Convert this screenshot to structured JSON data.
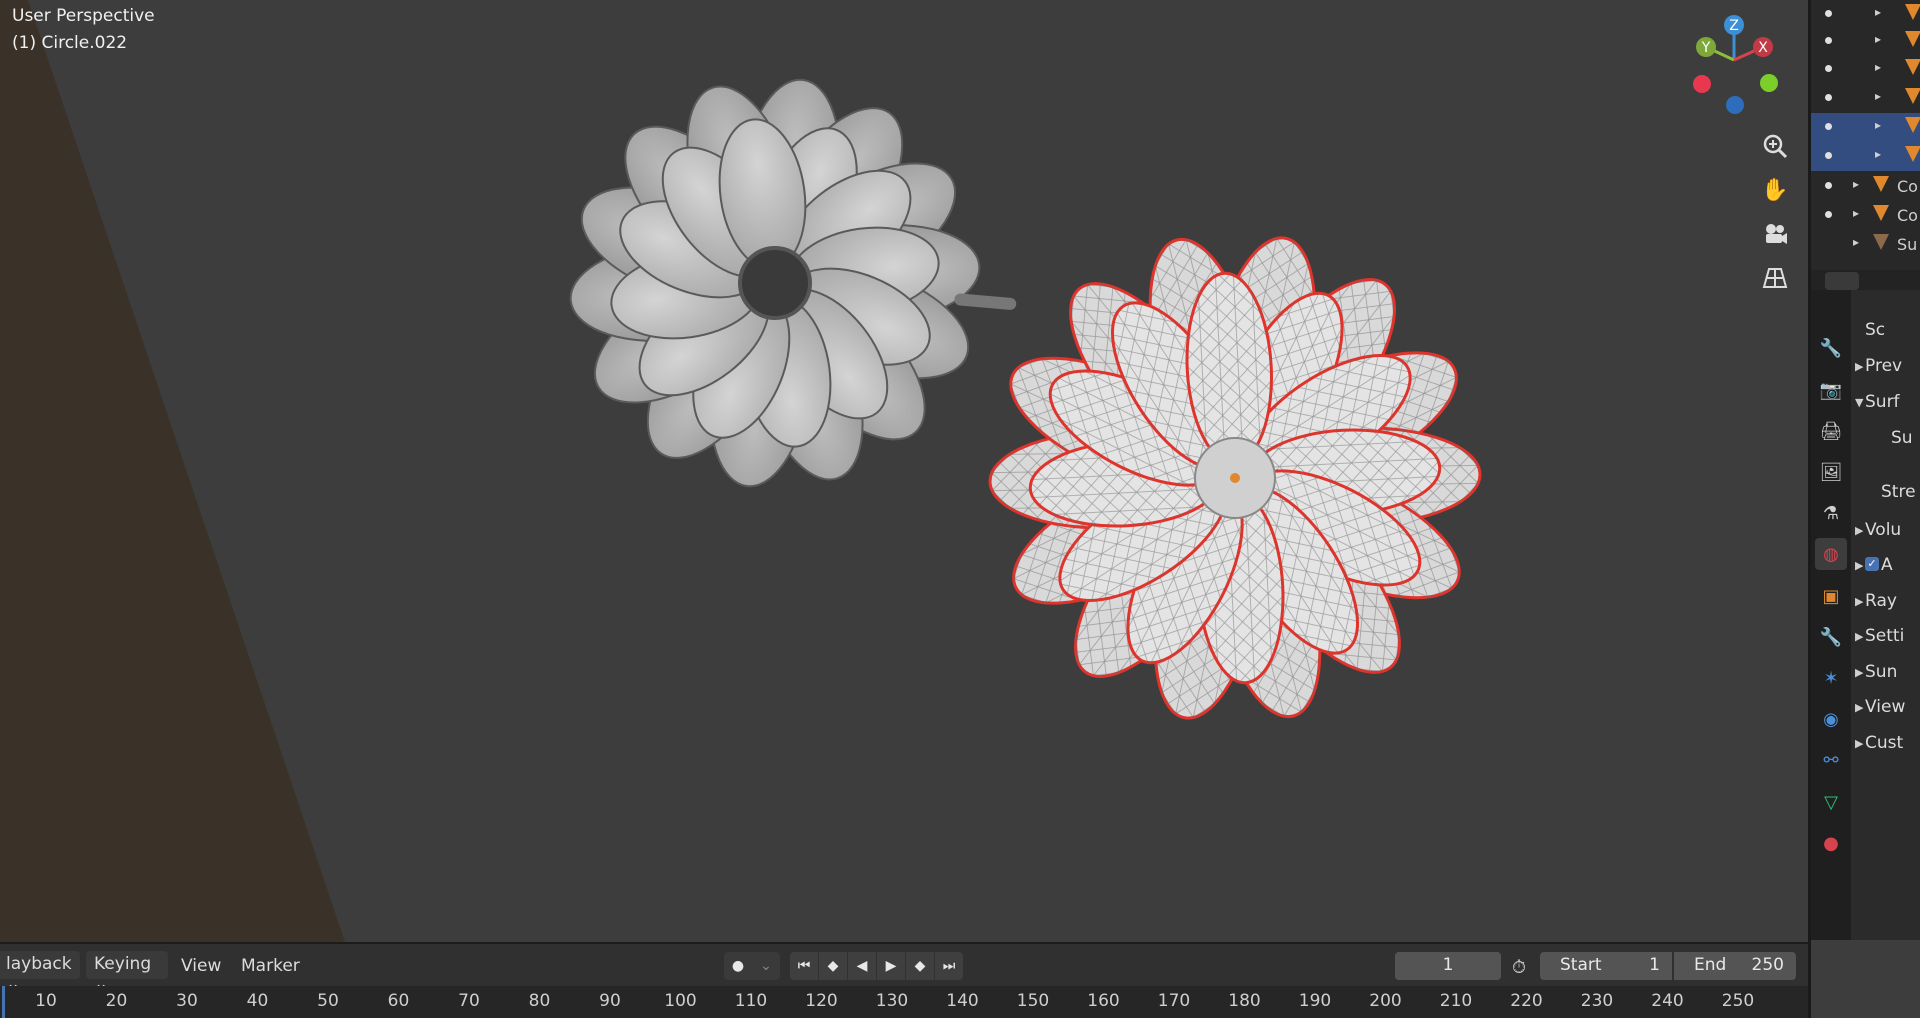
{
  "viewport": {
    "title": "User Perspective",
    "object": "(1) Circle.022",
    "gizmo": {
      "z": "Z",
      "y": "Y",
      "x": "X"
    },
    "nav_icons": [
      "zoom-icon",
      "hand-pan-icon",
      "camera-icon",
      "grid-perspective-icon"
    ]
  },
  "outliner": {
    "items": [
      {
        "label": ""
      },
      {
        "label": ""
      },
      {
        "label": ""
      },
      {
        "label": ""
      },
      {
        "label": ""
      },
      {
        "label": ""
      },
      {
        "label": "Co"
      },
      {
        "label": "Co"
      },
      {
        "label": "Su"
      }
    ]
  },
  "properties": {
    "header_label": "Sc",
    "rows": [
      "Prev",
      "Surf",
      "Su",
      "Stre",
      "Volu",
      "A",
      "Ray",
      "Setti",
      "Sun",
      "View",
      "Cust"
    ]
  },
  "timeline": {
    "menus": [
      "layback",
      "Keying",
      "View",
      "Marker"
    ],
    "current_frame": "1",
    "start_label": "Start",
    "start_value": "1",
    "end_label": "End",
    "end_value": "250",
    "ticks": [
      "10",
      "20",
      "30",
      "40",
      "50",
      "60",
      "70",
      "80",
      "90",
      "100",
      "110",
      "120",
      "130",
      "140",
      "150",
      "160",
      "170",
      "180",
      "190",
      "200",
      "210",
      "220",
      "230",
      "240",
      "250"
    ]
  },
  "colors": {
    "accent": "#4772b3",
    "selection": "#e0332b",
    "mesh_tri": "#e0882e"
  }
}
